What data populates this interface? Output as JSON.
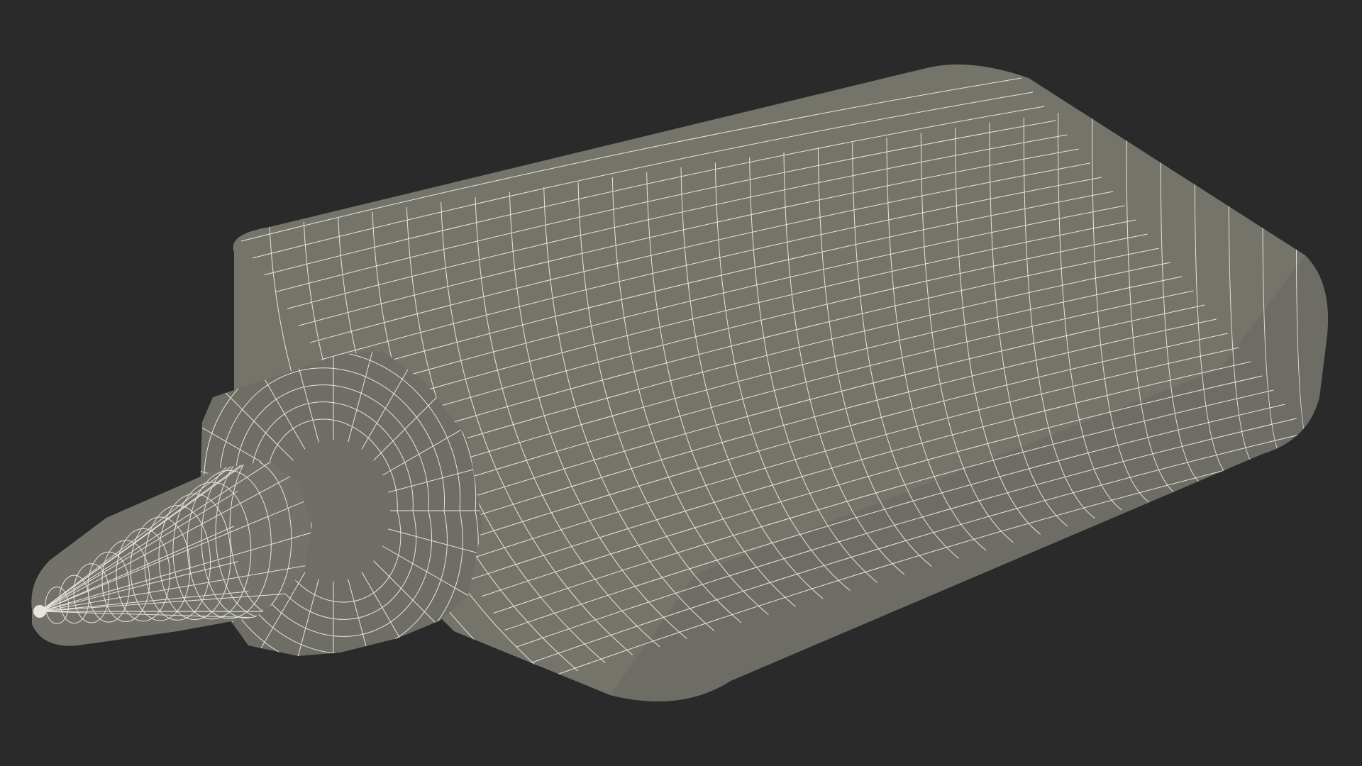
{
  "scene": {
    "subject_icon": "wireframe-bottle-icon",
    "background_color": "#2a2a2a",
    "surface_color": "#74746b",
    "surface_shadow_color": "#5f5f57",
    "wire_color": "#e6e6dc"
  }
}
